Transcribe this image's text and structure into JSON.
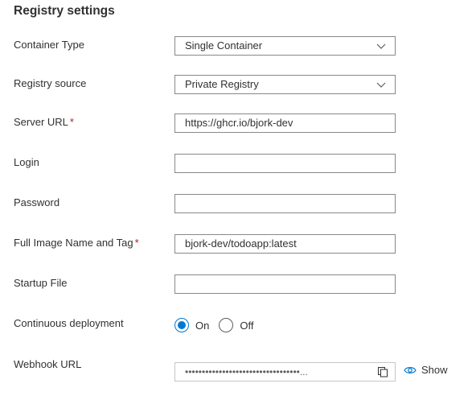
{
  "section": {
    "title": "Registry settings"
  },
  "fields": {
    "container_type": {
      "label": "Container Type",
      "value": "Single Container"
    },
    "registry_source": {
      "label": "Registry source",
      "value": "Private Registry"
    },
    "server_url": {
      "label": "Server URL",
      "required_mark": "*",
      "value": "https://ghcr.io/bjork-dev"
    },
    "login": {
      "label": "Login",
      "value": ""
    },
    "password": {
      "label": "Password",
      "value": ""
    },
    "image_name": {
      "label": "Full Image Name and Tag",
      "required_mark": "*",
      "value": "bjork-dev/todoapp:latest"
    },
    "startup_file": {
      "label": "Startup File",
      "value": ""
    },
    "continuous_deployment": {
      "label": "Continuous deployment",
      "on_label": "On",
      "off_label": "Off",
      "selected": "On"
    },
    "webhook_url": {
      "label": "Webhook URL",
      "masked_value": "••••••••••••••••••••••••••••••••••...",
      "show_label": "Show"
    }
  },
  "icons": {
    "select_chevron": "chevron-down-icon",
    "copy": "copy-icon",
    "show": "eye-icon"
  },
  "colors": {
    "accent": "#0078d4",
    "required": "#a4262c",
    "border": "#8a8886",
    "text": "#323130"
  }
}
